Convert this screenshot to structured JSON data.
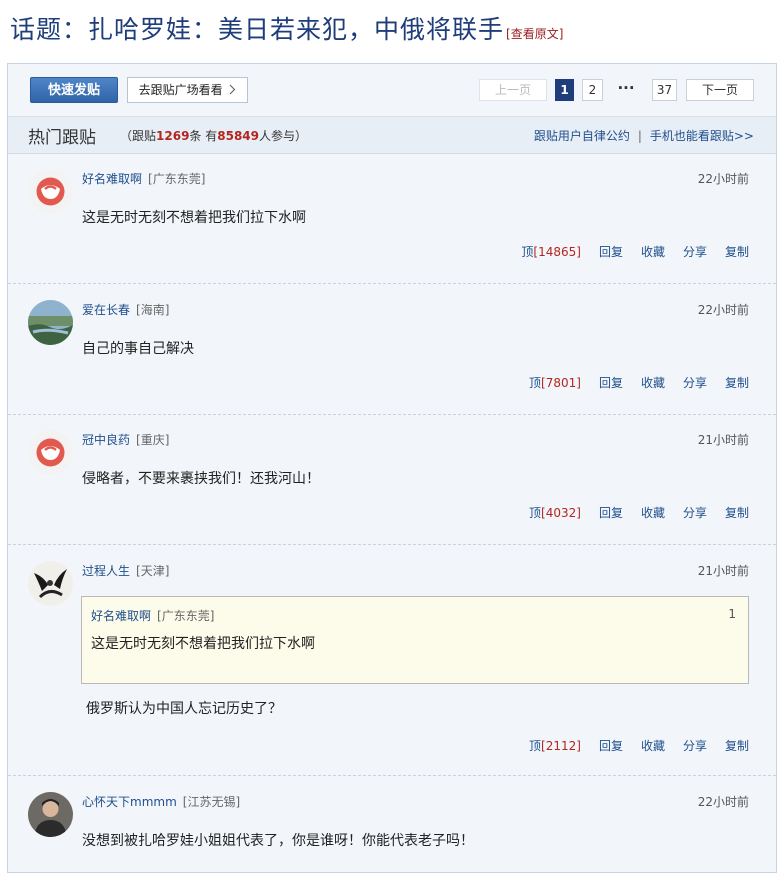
{
  "topic": {
    "title": "话题：扎哈罗娃：美日若来犯，中俄将联手",
    "view_original": "[查看原文]"
  },
  "toolbar": {
    "post_button": "快速发贴",
    "plaza_button": "去跟贴广场看看",
    "pagination": {
      "prev": "上一页",
      "pages": [
        "1",
        "2"
      ],
      "current": "1",
      "ellipsis": "···",
      "last": "37",
      "next": "下一页"
    }
  },
  "hot": {
    "title": "热门跟贴",
    "stats_prefix": "（跟贴",
    "reply_count": "1269",
    "stats_mid": "条 有",
    "participant_count": "85849",
    "stats_suffix": "人参与）",
    "rules_link": "跟贴用户自律公约",
    "separator": "|",
    "mobile_link": "手机也能看跟贴>>"
  },
  "comments": [
    {
      "user": "好名难取啊",
      "location": "[广东东莞]",
      "time": "22小时前",
      "text": "这是无时无刻不想着把我们拉下水啊",
      "vote_label": "顶",
      "votes": "[14865]",
      "reply": "回复",
      "favorite": "收藏",
      "share": "分享",
      "copy": "复制",
      "avatar": "netease-default-avatar"
    },
    {
      "user": "爱在长春",
      "location": "[海南]",
      "time": "22小时前",
      "text": "自己的事自己解决",
      "vote_label": "顶",
      "votes": "[7801]",
      "reply": "回复",
      "favorite": "收藏",
      "share": "分享",
      "copy": "复制",
      "avatar": "landscape-photo-avatar"
    },
    {
      "user": "冠中良药",
      "location": "[重庆]",
      "time": "21小时前",
      "text": "侵略者，不要来裹挟我们！还我河山！",
      "vote_label": "顶",
      "votes": "[4032]",
      "reply": "回复",
      "favorite": "收藏",
      "share": "分享",
      "copy": "复制",
      "avatar": "netease-default-avatar"
    },
    {
      "user": "过程人生",
      "location": "[天津]",
      "time": "21小时前",
      "quote": {
        "user": "好名难取啊",
        "location": "[广东东莞]",
        "floor": "1",
        "text": "这是无时无刻不想着把我们拉下水啊"
      },
      "text": "俄罗斯认为中国人忘记历史了？",
      "vote_label": "顶",
      "votes": "[2112]",
      "reply": "回复",
      "favorite": "收藏",
      "share": "分享",
      "copy": "复制",
      "avatar": "ink-art-avatar"
    },
    {
      "user": "心怀天下mmmm",
      "location": "[江苏无锡]",
      "time": "22小时前",
      "text": "没想到被扎哈罗娃小姐姐代表了，你是谁呀！你能代表老子吗！",
      "avatar": "person-photo-avatar"
    }
  ],
  "colors": {
    "brand_blue": "#1f3d7a",
    "link_blue": "#1f4f8c",
    "accent_red": "#b3261e",
    "panel_bg": "#f2f6fb"
  }
}
